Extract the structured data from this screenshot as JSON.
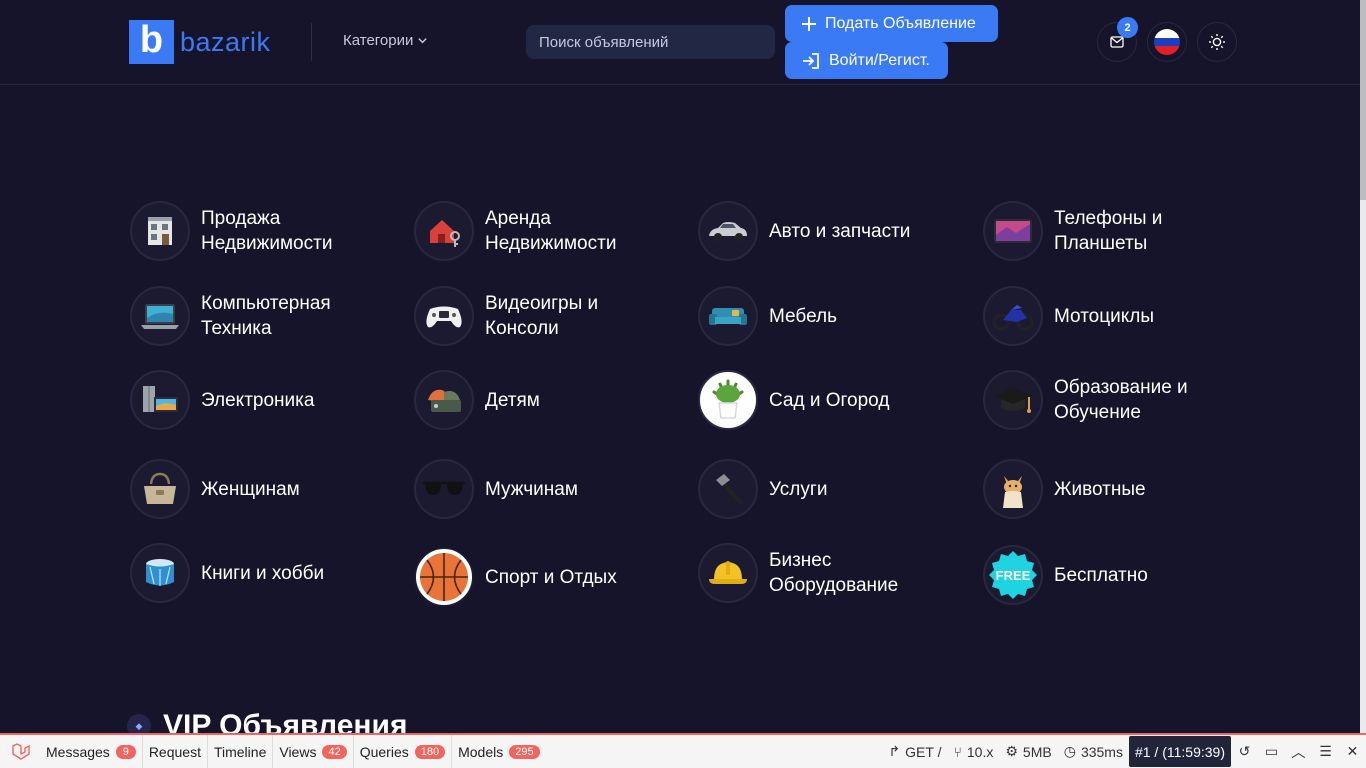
{
  "header": {
    "logo_letter": "b",
    "logo_text": "bazarik",
    "categories_label": "Категории",
    "search_placeholder": "Поиск объявлений",
    "post_ad_label": "Подать Объявление",
    "login_label": "Войти/Регист.",
    "mail_badge": "2",
    "accent_color": "#3a7bf5"
  },
  "categories": [
    {
      "label": "Продажа\nНедвижимости",
      "icon": "building-icon"
    },
    {
      "label": "Аренда\nНедвижимости",
      "icon": "house-key-icon"
    },
    {
      "label": "Авто и запчасти",
      "icon": "car-icon"
    },
    {
      "label": "Телефоны и\nПланшеты",
      "icon": "tablet-icon"
    },
    {
      "label": "Компьютерная\nТехника",
      "icon": "laptop-icon"
    },
    {
      "label": "Видеоигры и\nКонсоли",
      "icon": "gamepad-icon"
    },
    {
      "label": "Мебель",
      "icon": "sofa-icon"
    },
    {
      "label": "Мотоциклы",
      "icon": "motorcycle-icon"
    },
    {
      "label": "Электроника",
      "icon": "appliances-icon"
    },
    {
      "label": "Детям",
      "icon": "toys-icon"
    },
    {
      "label": "Сад и Огород",
      "icon": "plant-icon"
    },
    {
      "label": "Образование и\nОбучение",
      "icon": "graduation-cap-icon"
    },
    {
      "label": "Женщинам",
      "icon": "handbag-icon"
    },
    {
      "label": "Мужчинам",
      "icon": "sunglasses-icon"
    },
    {
      "label": "Услуги",
      "icon": "hammer-icon"
    },
    {
      "label": "Животные",
      "icon": "cat-icon"
    },
    {
      "label": "Книги и хобби",
      "icon": "drum-icon"
    },
    {
      "label": "Спорт и Отдых",
      "icon": "basketball-icon"
    },
    {
      "label": "Бизнес\nОборудование",
      "icon": "hard-hat-icon"
    },
    {
      "label": "Бесплатно",
      "icon": "free-badge-icon",
      "icon_text": "FREE"
    }
  ],
  "vip": {
    "title": "VIP Объявления"
  },
  "debugbar": {
    "tabs": [
      {
        "label": "Messages",
        "count": "9"
      },
      {
        "label": "Request",
        "count": ""
      },
      {
        "label": "Timeline",
        "count": ""
      },
      {
        "label": "Views",
        "count": "42"
      },
      {
        "label": "Queries",
        "count": "180"
      },
      {
        "label": "Models",
        "count": "295"
      }
    ],
    "method": "GET /",
    "version": "10.x",
    "memory": "5MB",
    "time": "335ms",
    "request_id": "#1 / (11:59:39)"
  }
}
